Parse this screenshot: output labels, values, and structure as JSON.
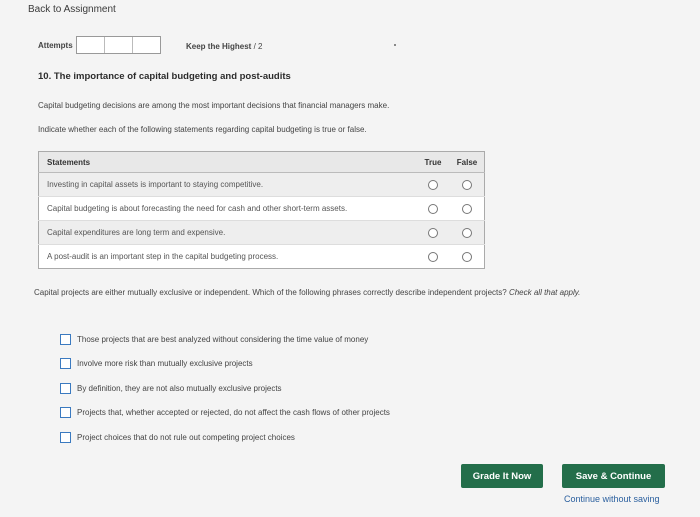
{
  "nav": {
    "back_label": "Back to Assignment"
  },
  "attempts": {
    "label": "Attempts",
    "keep_label": "Keep the Highest",
    "keep_value": "/ 2"
  },
  "question": {
    "title": "10. The importance of capital budgeting and post-audits",
    "intro": "Capital budgeting decisions are among the most important decisions that financial managers make.",
    "instruction": "Indicate whether each of the following statements regarding capital budgeting is true or false."
  },
  "table": {
    "headers": {
      "statement": "Statements",
      "true": "True",
      "false": "False"
    },
    "rows": [
      "Investing in capital assets is important to staying competitive.",
      "Capital budgeting is about forecasting the need for cash and other short-term assets.",
      "Capital expenditures are long term and expensive.",
      "A post-audit is an important step in the capital budgeting process."
    ]
  },
  "part2": {
    "prompt": "Capital projects are either mutually exclusive or independent. Which of the following phrases correctly describe independent projects?",
    "hint": "Check all that apply.",
    "options": [
      "Those projects that are best analyzed without considering the time value of money",
      "Involve more risk than mutually exclusive projects",
      "By definition, they are not also mutually exclusive projects",
      "Projects that, whether accepted or rejected, do not affect the cash flows of other projects",
      "Project choices that do not rule out competing project choices"
    ]
  },
  "actions": {
    "grade_label": "Grade It Now",
    "save_label": "Save & Continue",
    "continue_label": "Continue without saving"
  },
  "colors": {
    "button_bg": "#236e4a",
    "link": "#2a5f9e",
    "checkbox_border": "#3b7ac0"
  }
}
